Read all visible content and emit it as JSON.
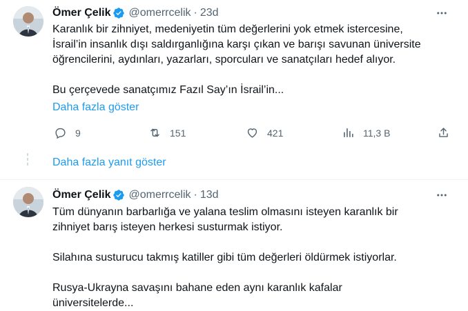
{
  "tweets": [
    {
      "name": "Ömer Çelik",
      "handle": "@omerrcelik",
      "dot": "·",
      "time": "23d",
      "lines": [
        "Karanlık bir zihniyet, medeniyetin tüm değerlerini yok etmek istercesine,",
        "İsrail’in insanlık dışı saldırganlığına karşı çıkan ve barışı savunan üniversite",
        "öğrencilerini, aydınları, yazarları, sporcuları  ve sanatçıları hedef alıyor.",
        "Bu çerçevede sanatçımız Fazıl Say’ın İsrail’in..."
      ],
      "show_more": "Daha fazla göster",
      "stats": {
        "replies": "9",
        "reposts": "151",
        "likes": "421",
        "views": "11,3 B"
      }
    },
    {
      "name": "Ömer Çelik",
      "handle": "@omerrcelik",
      "dot": "·",
      "time": "13d",
      "lines": [
        "Tüm dünyanın barbarlığa ve yalana teslim olmasını isteyen karanlık bir",
        "zihniyet barış isteyen herkesi susturmak istiyor.",
        "Silahına susturucu takmış katiller gibi tüm değerleri öldürmek istiyorlar.",
        "Rusya-Ukrayna savaşını bahane eden aynı karanlık kafalar",
        "üniversitelerde..."
      ]
    }
  ],
  "show_replies": "Daha fazla yanıt göster",
  "colors": {
    "link": "#1d9bf0",
    "secondary": "#536471",
    "verified": "#1d9bf0"
  },
  "icons": [
    "verified-badge-icon",
    "more-options-icon",
    "reply-icon",
    "repost-icon",
    "like-icon",
    "views-icon",
    "share-icon"
  ]
}
